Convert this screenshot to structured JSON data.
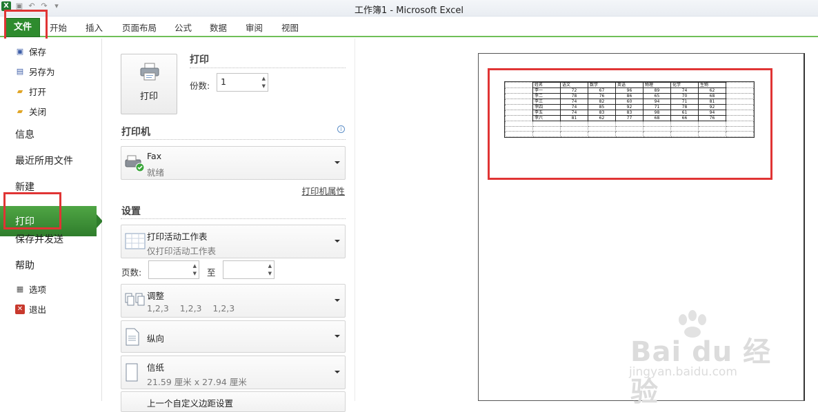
{
  "window": {
    "title": "工作簿1  -  Microsoft Excel"
  },
  "qat": {
    "app_icon": "X"
  },
  "ribbon": {
    "file_tab": "文件",
    "tabs": [
      "开始",
      "插入",
      "页面布局",
      "公式",
      "数据",
      "审阅",
      "视图"
    ]
  },
  "backstage": {
    "commands": [
      {
        "label": "保存",
        "icon": "save-icon"
      },
      {
        "label": "另存为",
        "icon": "save-as-icon"
      },
      {
        "label": "打开",
        "icon": "open-folder-icon"
      },
      {
        "label": "关闭",
        "icon": "close-folder-icon"
      }
    ],
    "nav": [
      "信息",
      "最近所用文件",
      "新建",
      "打印",
      "保存并发送",
      "帮助"
    ],
    "bottom": [
      {
        "label": "选项",
        "icon": "options-icon"
      },
      {
        "label": "退出",
        "icon": "exit-icon"
      }
    ]
  },
  "print_panel": {
    "print_title": "打印",
    "print_button": "打印",
    "copies_label": "份数:",
    "copies_value": "1",
    "printer_title": "打印机",
    "printer_name": "Fax",
    "printer_status": "就绪",
    "printer_properties": "打印机属性",
    "settings_title": "设置",
    "what_title": "打印活动工作表",
    "what_sub": "仅打印活动工作表",
    "pages_label": "页数:",
    "to_label": "至",
    "collate_title": "调整",
    "collate_sub": "1,2,3    1,2,3    1,2,3",
    "orientation": "纵向",
    "paper_title": "信纸",
    "paper_sub": "21.59 厘米 x 27.94 厘米",
    "margins_title": "上一个自定义边距设置"
  },
  "preview": {
    "headers": [
      "",
      "姓名",
      "语文",
      "数学",
      "英语",
      "物理",
      "化学",
      "生物",
      ""
    ],
    "rows": [
      [
        "",
        "李一",
        "72",
        "67",
        "96",
        "89",
        "74",
        "62",
        ""
      ],
      [
        "",
        "李二",
        "78",
        "76",
        "86",
        "65",
        "70",
        "68",
        ""
      ],
      [
        "",
        "李三",
        "74",
        "82",
        "60",
        "94",
        "71",
        "81",
        ""
      ],
      [
        "",
        "李四",
        "74",
        "85",
        "92",
        "71",
        "78",
        "92",
        ""
      ],
      [
        "",
        "李五",
        "74",
        "83",
        "83",
        "98",
        "61",
        "94",
        ""
      ],
      [
        "",
        "李六",
        "81",
        "62",
        "77",
        "68",
        "66",
        "76",
        ""
      ],
      [
        "",
        "",
        "",
        "",
        "",
        "",
        "",
        "",
        ""
      ],
      [
        "",
        "",
        "",
        "",
        "",
        "",
        "",
        "",
        ""
      ],
      [
        "",
        "",
        "",
        "",
        "",
        "",
        "",
        "",
        ""
      ]
    ]
  },
  "watermark": {
    "brand": "Bai du 经验",
    "url": "jingyan.baidu.com"
  }
}
